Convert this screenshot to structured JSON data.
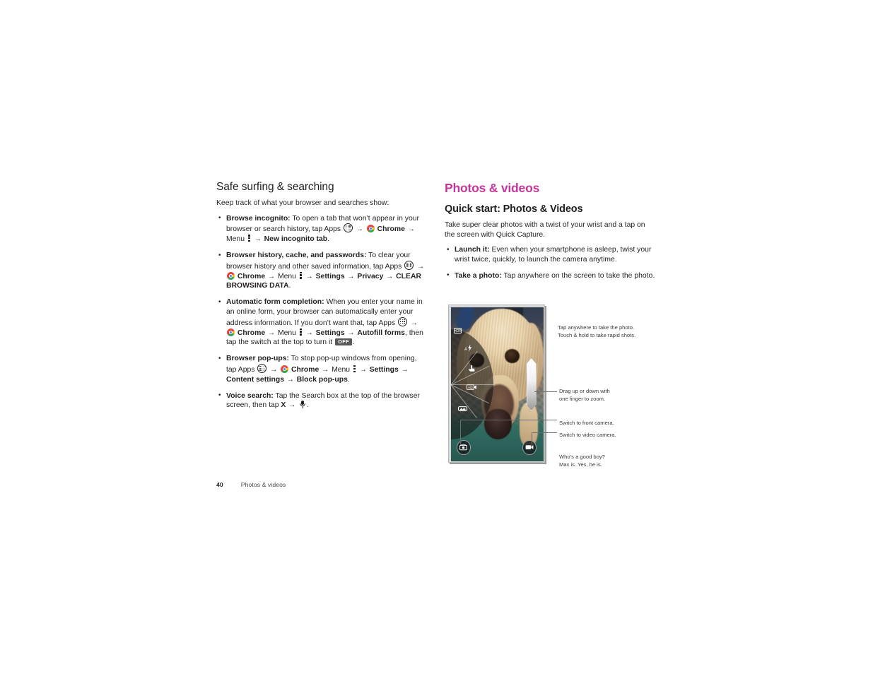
{
  "footer": {
    "page_number": "40",
    "chapter": "Photos & videos"
  },
  "left_column": {
    "heading": "Safe surfing & searching",
    "intro": "Keep track of what your browser and searches show:",
    "bullets": [
      {
        "term": "Browse incognito:",
        "text_1": "To open a tab that won’t appear in your browser or search history, tap Apps",
        "icon_1": "apps-grid-icon",
        "arrow_1": "→",
        "icon_2": "chrome-icon",
        "bold_1": "Chrome",
        "arrow_2": "→",
        "plain_1": "Menu",
        "icon_3": "overflow-menu-icon",
        "arrow_3": "→",
        "bold_2": "New incognito tab",
        "tail": "."
      },
      {
        "term": "Browser history, cache, and passwords:",
        "text_1": "To clear your browser history and other saved information, tap Apps",
        "icon_1": "apps-grid-icon",
        "arrow_1": "→",
        "icon_2": "chrome-icon",
        "bold_1": "Chrome",
        "arrow_2": "→",
        "plain_1": "Menu",
        "icon_3": "overflow-menu-icon",
        "arrow_3": "→",
        "bold_2": "Settings",
        "arrow_4": "→",
        "bold_3": "Privacy",
        "arrow_5": "→",
        "bold_4": "CLEAR BROWSING DATA",
        "tail": "."
      },
      {
        "term": "Automatic form completion:",
        "text_1": "When you enter your name in an online form, your browser can automatically enter your address information. If you don’t want that, tap Apps",
        "icon_1": "apps-grid-icon",
        "arrow_1": "→",
        "icon_2": "chrome-icon",
        "bold_1": "Chrome",
        "arrow_2": "→",
        "plain_1": "Menu",
        "icon_3": "overflow-menu-icon",
        "arrow_3": "→",
        "bold_2": "Settings",
        "arrow_4": "→",
        "bold_3": "Autofill forms",
        "text_2": ", then tap the switch at the top to turn it",
        "switch_label": "OFF",
        "tail": "."
      },
      {
        "term": "Browser pop-ups:",
        "text_1": "To stop pop-up windows from opening, tap Apps",
        "icon_1": "apps-grid-icon",
        "arrow_1": "→",
        "icon_2": "chrome-icon",
        "bold_1": "Chrome",
        "arrow_2": "→",
        "plain_1": "Menu",
        "icon_3": "overflow-menu-icon",
        "arrow_3": "→",
        "bold_2": "Settings",
        "arrow_4": "→",
        "bold_3": "Content settings",
        "arrow_5": "→",
        "bold_4": "Block pop-ups",
        "tail": "."
      },
      {
        "term": "Voice search:",
        "text_1": "Tap the Search box at the top of the browser screen, then tap",
        "bold_1": "X",
        "arrow_1": "→",
        "icon_1": "microphone-icon",
        "tail": "."
      }
    ]
  },
  "right_column": {
    "chapter_heading": "Photos & videos",
    "sub_heading": "Quick start: Photos & Videos",
    "intro": "Take super clear photos with a twist of your wrist and a tap on the screen with Quick Capture.",
    "bullets": [
      {
        "term": "Launch it:",
        "text": "Even when your smartphone is asleep, twist your wrist twice, quickly, to launch the camera anytime."
      },
      {
        "term": "Take a photo:",
        "text": "Tap anywhere on the screen to take the photo."
      }
    ]
  },
  "figure": {
    "device": "smartphone-camera-viewfinder",
    "photo_subject": "golden retriever dog close-up",
    "radial_menu_icons": [
      "hdr-icon",
      "flash-auto-icon",
      "touch-capture-icon",
      "video-resolution-icon",
      "panorama-icon"
    ],
    "controls": {
      "zoom_slider": "zoom-slider",
      "front_camera_button": "switch-to-front-camera-icon",
      "video_camera_button": "switch-to-video-camera-icon"
    },
    "callouts": [
      {
        "id": "tap-to-capture",
        "line_1": "Tap anywhere to take the photo.",
        "line_2": "Touch & hold to take rapid shots."
      },
      {
        "id": "zoom",
        "line_1": "Drag up or down with",
        "line_2": "one finger to zoom."
      },
      {
        "id": "front-camera",
        "line_1": "Switch to front camera."
      },
      {
        "id": "video-camera",
        "line_1": "Switch to video camera."
      },
      {
        "id": "caption",
        "line_1": "Who’s a good boy?",
        "line_2": "Max is. Yes, he is."
      }
    ]
  },
  "colors": {
    "chapter_accent": "#c3379b",
    "body_text": "#231f20",
    "callout_text": "#3a3a3a",
    "switch_badge": "#585858"
  }
}
